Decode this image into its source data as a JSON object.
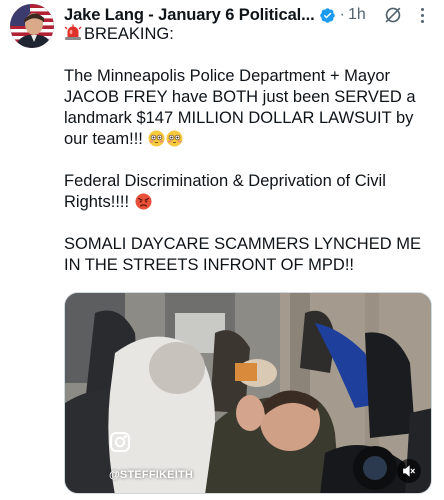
{
  "tweet": {
    "author_name": "Jake Lang - January 6 Political...",
    "separator": "·",
    "time": "1h",
    "line_breaking": "BREAKING:",
    "paragraph1": "The Minneapolis Police Department + Mayor JACOB FREY have BOTH just been SERVED a landmark $147 MILLION DOLLAR LAWSUIT by our team!!!",
    "paragraph2": "Federal Discrimination & Deprivation of Civil Rights!!!!",
    "paragraph3": "SOMALI DAYCARE SCAMMERS LYNCHED ME IN THE STREETS INFRONT OF MPD!!"
  },
  "media": {
    "watermark": "@STEFFIKEITH",
    "watermark_icon": "instagram-icon",
    "mute_icon": "speaker-muted-icon"
  },
  "colors": {
    "text": "#0f1419",
    "muted": "#536471",
    "verified": "#1d9bf0",
    "border": "#cfd9de"
  }
}
